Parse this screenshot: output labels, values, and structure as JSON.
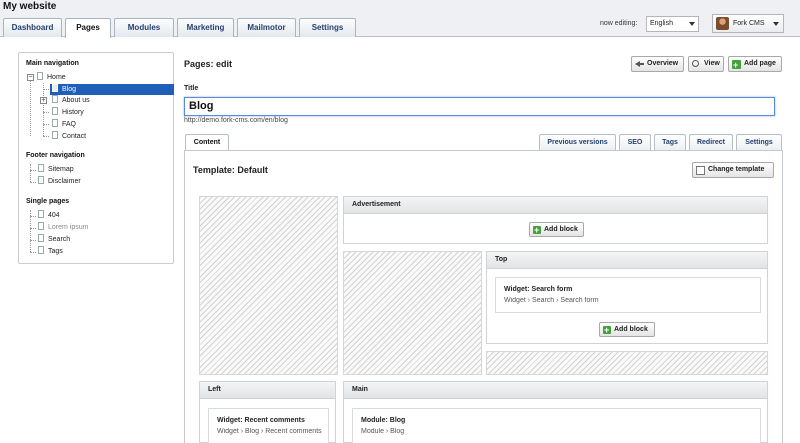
{
  "header": {
    "site_title": "My website",
    "tabs": [
      {
        "label": "Dashboard"
      },
      {
        "label": "Pages"
      },
      {
        "label": "Modules"
      },
      {
        "label": "Marketing"
      },
      {
        "label": "Mailmotor"
      },
      {
        "label": "Settings"
      }
    ],
    "active_tab": "Pages",
    "editing_label": "now editing:",
    "language": "English",
    "user_name": "Fork CMS"
  },
  "tree": {
    "main_heading": "Main navigation",
    "main_items": [
      {
        "label": "Home"
      },
      {
        "label": "Blog"
      },
      {
        "label": "About us"
      },
      {
        "label": "History"
      },
      {
        "label": "FAQ"
      },
      {
        "label": "Contact"
      }
    ],
    "selected": "Blog",
    "footer_heading": "Footer navigation",
    "footer_items": [
      {
        "label": "Sitemap"
      },
      {
        "label": "Disclaimer"
      }
    ],
    "single_heading": "Single pages",
    "single_items": [
      {
        "label": "404"
      },
      {
        "label": "Lorem ipsum"
      },
      {
        "label": "Search"
      },
      {
        "label": "Tags"
      }
    ]
  },
  "main": {
    "page_title": "Pages: edit",
    "buttons": {
      "overview": "Overview",
      "view": "View",
      "add_page": "Add page"
    },
    "title_label": "Title",
    "title_value": "Blog",
    "url": "http://demo.fork-cms.com/en/blog",
    "content_tabs": {
      "content": "Content",
      "previous_versions": "Previous versions",
      "seo": "SEO",
      "tags": "Tags",
      "redirect": "Redirect",
      "settings": "Settings"
    },
    "template_title": "Template: Default",
    "change_template": "Change template",
    "add_block": "Add block",
    "blocks": {
      "advertisement": "Advertisement",
      "top": "Top",
      "top_widget_title": "Widget: Search form",
      "top_widget_path": "Widget › Search › Search form",
      "left": "Left",
      "left_widget_title": "Widget: Recent comments",
      "left_widget_path": "Widget › Blog › Recent comments",
      "main": "Main",
      "main_module_title": "Module: Blog",
      "main_module_path": "Module › Blog"
    }
  }
}
